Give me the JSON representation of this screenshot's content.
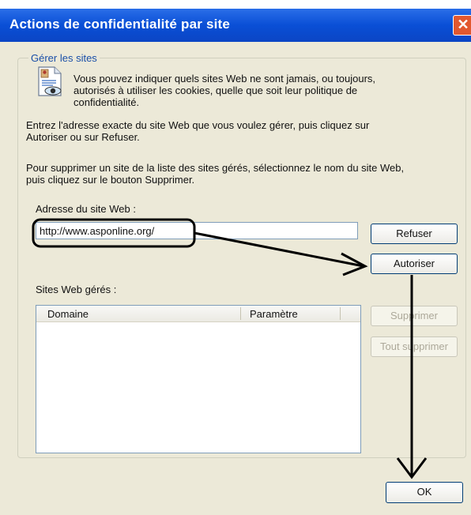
{
  "window": {
    "title": "Actions de confidentialité par site",
    "close_glyph": "✕"
  },
  "group": {
    "legend": "Gérer les sites",
    "icon": "privacy-document-eye-icon",
    "intro_lines": [
      "Vous pouvez indiquer quels sites Web ne sont jamais, ou toujours,",
      "autorisés à utiliser les cookies, quelle que soit leur politique de",
      "confidentialité."
    ],
    "instructions_1": [
      "Entrez l'adresse exacte du site Web que vous voulez gérer, puis cliquez sur",
      "Autoriser ou sur Refuser."
    ],
    "instructions_2": [
      "Pour supprimer un site de la liste des sites gérés, sélectionnez le nom du site Web,",
      "puis cliquez sur le bouton Supprimer."
    ],
    "address_label": "Adresse du site Web :",
    "address_value": "http://www.asponline.org/",
    "managed_label": "Sites Web gérés :",
    "columns": [
      "Domaine",
      "Paramètre"
    ],
    "rows": []
  },
  "buttons": {
    "block": "Refuser",
    "allow": "Autoriser",
    "remove": "Supprimer",
    "remove_all": "Tout supprimer",
    "ok": "OK"
  },
  "colors": {
    "titlebar": "#0a4fd6",
    "dialog_bg": "#ece9d8",
    "annotation": "#000000"
  }
}
